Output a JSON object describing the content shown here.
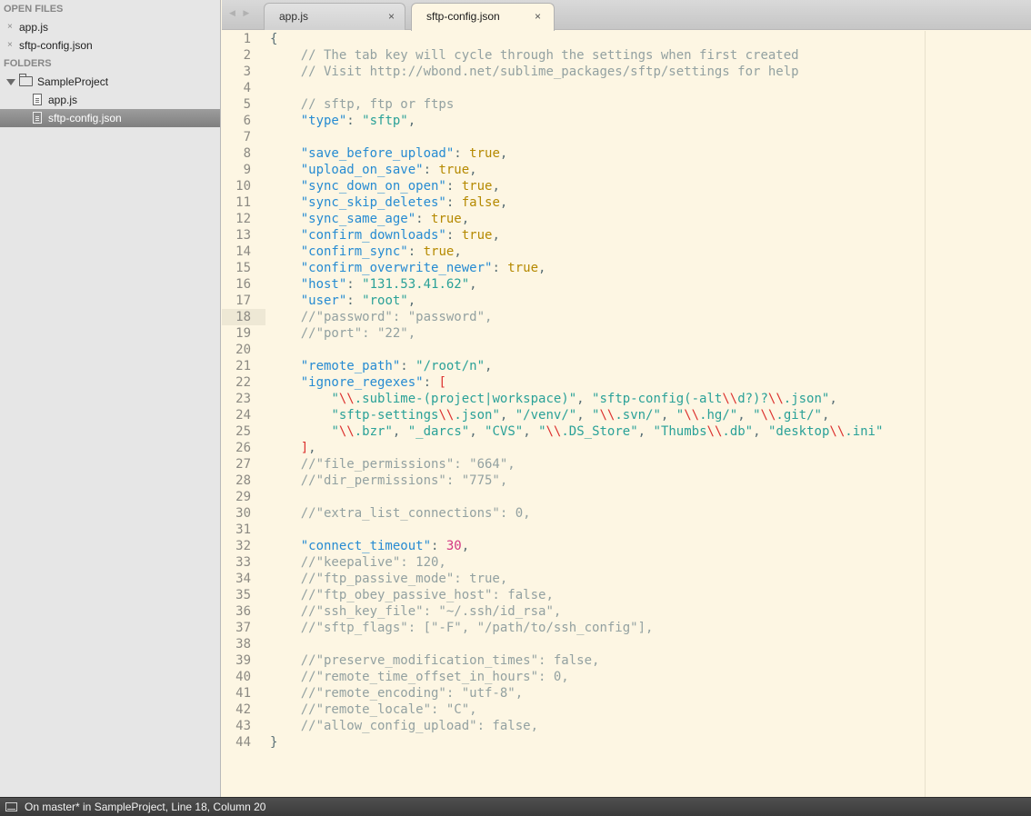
{
  "sidebar": {
    "open_files_header": "OPEN FILES",
    "open_files": [
      {
        "label": "app.js"
      },
      {
        "label": "sftp-config.json"
      }
    ],
    "close_glyph": "×",
    "folders_header": "FOLDERS",
    "project": {
      "label": "SampleProject"
    },
    "files": [
      {
        "label": "app.js",
        "selected": false
      },
      {
        "label": "sftp-config.json",
        "selected": true
      }
    ]
  },
  "tabs": [
    {
      "label": "app.js",
      "active": false,
      "close": "×"
    },
    {
      "label": "sftp-config.json",
      "active": true,
      "close": "×"
    }
  ],
  "nav_arrows": "◀ ▶",
  "editor": {
    "active_line": 18,
    "lines": [
      [
        [
          "punc",
          "{"
        ]
      ],
      [
        [
          "punc",
          "    "
        ],
        [
          "com",
          "// The tab key will cycle through the settings when first created"
        ]
      ],
      [
        [
          "punc",
          "    "
        ],
        [
          "com",
          "// Visit http://wbond.net/sublime_packages/sftp/settings for help"
        ]
      ],
      [
        [
          "punc",
          ""
        ]
      ],
      [
        [
          "punc",
          "    "
        ],
        [
          "com",
          "// sftp, ftp or ftps"
        ]
      ],
      [
        [
          "punc",
          "    "
        ],
        [
          "key",
          "\"type\""
        ],
        [
          "punc",
          ": "
        ],
        [
          "str",
          "\"sftp\""
        ],
        [
          "punc",
          ","
        ]
      ],
      [
        [
          "punc",
          ""
        ]
      ],
      [
        [
          "punc",
          "    "
        ],
        [
          "key",
          "\"save_before_upload\""
        ],
        [
          "punc",
          ": "
        ],
        [
          "bool",
          "true"
        ],
        [
          "punc",
          ","
        ]
      ],
      [
        [
          "punc",
          "    "
        ],
        [
          "key",
          "\"upload_on_save\""
        ],
        [
          "punc",
          ": "
        ],
        [
          "bool",
          "true"
        ],
        [
          "punc",
          ","
        ]
      ],
      [
        [
          "punc",
          "    "
        ],
        [
          "key",
          "\"sync_down_on_open\""
        ],
        [
          "punc",
          ": "
        ],
        [
          "bool",
          "true"
        ],
        [
          "punc",
          ","
        ]
      ],
      [
        [
          "punc",
          "    "
        ],
        [
          "key",
          "\"sync_skip_deletes\""
        ],
        [
          "punc",
          ": "
        ],
        [
          "bool",
          "false"
        ],
        [
          "punc",
          ","
        ]
      ],
      [
        [
          "punc",
          "    "
        ],
        [
          "key",
          "\"sync_same_age\""
        ],
        [
          "punc",
          ": "
        ],
        [
          "bool",
          "true"
        ],
        [
          "punc",
          ","
        ]
      ],
      [
        [
          "punc",
          "    "
        ],
        [
          "key",
          "\"confirm_downloads\""
        ],
        [
          "punc",
          ": "
        ],
        [
          "bool",
          "true"
        ],
        [
          "punc",
          ","
        ]
      ],
      [
        [
          "punc",
          "    "
        ],
        [
          "key",
          "\"confirm_sync\""
        ],
        [
          "punc",
          ": "
        ],
        [
          "bool",
          "true"
        ],
        [
          "punc",
          ","
        ]
      ],
      [
        [
          "punc",
          "    "
        ],
        [
          "key",
          "\"confirm_overwrite_newer\""
        ],
        [
          "punc",
          ": "
        ],
        [
          "bool",
          "true"
        ],
        [
          "punc",
          ","
        ]
      ],
      [
        [
          "punc",
          "    "
        ],
        [
          "key",
          "\"host\""
        ],
        [
          "punc",
          ": "
        ],
        [
          "str",
          "\"131.53.41.62\""
        ],
        [
          "punc",
          ","
        ]
      ],
      [
        [
          "punc",
          "    "
        ],
        [
          "key",
          "\"user\""
        ],
        [
          "punc",
          ": "
        ],
        [
          "str",
          "\"root\""
        ],
        [
          "punc",
          ","
        ]
      ],
      [
        [
          "punc",
          "    "
        ],
        [
          "com",
          "//\"password\": \"password\","
        ]
      ],
      [
        [
          "punc",
          "    "
        ],
        [
          "com",
          "//\"port\": \"22\","
        ]
      ],
      [
        [
          "punc",
          ""
        ]
      ],
      [
        [
          "punc",
          "    "
        ],
        [
          "key",
          "\"remote_path\""
        ],
        [
          "punc",
          ": "
        ],
        [
          "str",
          "\"/root/n\""
        ],
        [
          "punc",
          ","
        ]
      ],
      [
        [
          "punc",
          "    "
        ],
        [
          "key",
          "\"ignore_regexes\""
        ],
        [
          "punc",
          ": "
        ],
        [
          "brk",
          "["
        ]
      ],
      [
        [
          "punc",
          "        "
        ],
        [
          "str",
          "\""
        ],
        [
          "esc",
          "\\\\"
        ],
        [
          "str",
          ".sublime-(project|workspace)\""
        ],
        [
          "punc",
          ", "
        ],
        [
          "str",
          "\"sftp-config(-alt"
        ],
        [
          "esc",
          "\\\\"
        ],
        [
          "str",
          "d?)?"
        ],
        [
          "esc",
          "\\\\"
        ],
        [
          "str",
          ".json\""
        ],
        [
          "punc",
          ","
        ]
      ],
      [
        [
          "punc",
          "        "
        ],
        [
          "str",
          "\"sftp-settings"
        ],
        [
          "esc",
          "\\\\"
        ],
        [
          "str",
          ".json\""
        ],
        [
          "punc",
          ", "
        ],
        [
          "str",
          "\"/venv/\""
        ],
        [
          "punc",
          ", "
        ],
        [
          "str",
          "\""
        ],
        [
          "esc",
          "\\\\"
        ],
        [
          "str",
          ".svn/\""
        ],
        [
          "punc",
          ", "
        ],
        [
          "str",
          "\""
        ],
        [
          "esc",
          "\\\\"
        ],
        [
          "str",
          ".hg/\""
        ],
        [
          "punc",
          ", "
        ],
        [
          "str",
          "\""
        ],
        [
          "esc",
          "\\\\"
        ],
        [
          "str",
          ".git/\""
        ],
        [
          "punc",
          ","
        ]
      ],
      [
        [
          "punc",
          "        "
        ],
        [
          "str",
          "\""
        ],
        [
          "esc",
          "\\\\"
        ],
        [
          "str",
          ".bzr\""
        ],
        [
          "punc",
          ", "
        ],
        [
          "str",
          "\"_darcs\""
        ],
        [
          "punc",
          ", "
        ],
        [
          "str",
          "\"CVS\""
        ],
        [
          "punc",
          ", "
        ],
        [
          "str",
          "\""
        ],
        [
          "esc",
          "\\\\"
        ],
        [
          "str",
          ".DS_Store\""
        ],
        [
          "punc",
          ", "
        ],
        [
          "str",
          "\"Thumbs"
        ],
        [
          "esc",
          "\\\\"
        ],
        [
          "str",
          ".db\""
        ],
        [
          "punc",
          ", "
        ],
        [
          "str",
          "\"desktop"
        ],
        [
          "esc",
          "\\\\"
        ],
        [
          "str",
          ".ini\""
        ]
      ],
      [
        [
          "punc",
          "    "
        ],
        [
          "brk",
          "]"
        ],
        [
          "punc",
          ","
        ]
      ],
      [
        [
          "punc",
          "    "
        ],
        [
          "com",
          "//\"file_permissions\": \"664\","
        ]
      ],
      [
        [
          "punc",
          "    "
        ],
        [
          "com",
          "//\"dir_permissions\": \"775\","
        ]
      ],
      [
        [
          "punc",
          ""
        ]
      ],
      [
        [
          "punc",
          "    "
        ],
        [
          "com",
          "//\"extra_list_connections\": 0,"
        ]
      ],
      [
        [
          "punc",
          ""
        ]
      ],
      [
        [
          "punc",
          "    "
        ],
        [
          "key",
          "\"connect_timeout\""
        ],
        [
          "punc",
          ": "
        ],
        [
          "num",
          "30"
        ],
        [
          "punc",
          ","
        ]
      ],
      [
        [
          "punc",
          "    "
        ],
        [
          "com",
          "//\"keepalive\": 120,"
        ]
      ],
      [
        [
          "punc",
          "    "
        ],
        [
          "com",
          "//\"ftp_passive_mode\": true,"
        ]
      ],
      [
        [
          "punc",
          "    "
        ],
        [
          "com",
          "//\"ftp_obey_passive_host\": false,"
        ]
      ],
      [
        [
          "punc",
          "    "
        ],
        [
          "com",
          "//\"ssh_key_file\": \"~/.ssh/id_rsa\","
        ]
      ],
      [
        [
          "punc",
          "    "
        ],
        [
          "com",
          "//\"sftp_flags\": [\"-F\", \"/path/to/ssh_config\"],"
        ]
      ],
      [
        [
          "punc",
          ""
        ]
      ],
      [
        [
          "punc",
          "    "
        ],
        [
          "com",
          "//\"preserve_modification_times\": false,"
        ]
      ],
      [
        [
          "punc",
          "    "
        ],
        [
          "com",
          "//\"remote_time_offset_in_hours\": 0,"
        ]
      ],
      [
        [
          "punc",
          "    "
        ],
        [
          "com",
          "//\"remote_encoding\": \"utf-8\","
        ]
      ],
      [
        [
          "punc",
          "    "
        ],
        [
          "com",
          "//\"remote_locale\": \"C\","
        ]
      ],
      [
        [
          "punc",
          "    "
        ],
        [
          "com",
          "//\"allow_config_upload\": false,"
        ]
      ],
      [
        [
          "punc",
          "}"
        ]
      ]
    ]
  },
  "statusbar": {
    "text": "On master* in SampleProject, Line 18, Column 20"
  }
}
